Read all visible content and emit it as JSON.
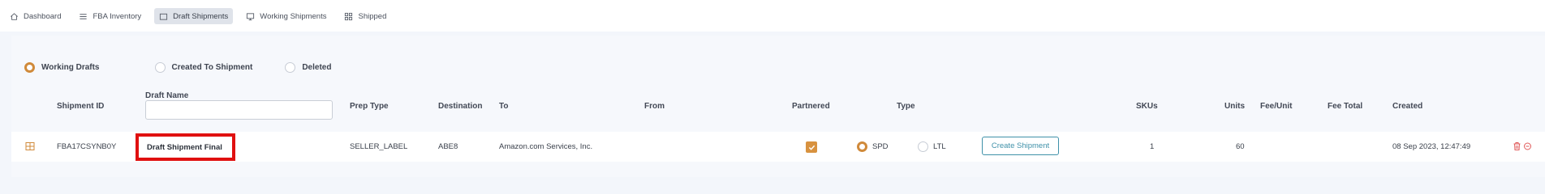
{
  "nav": {
    "items": [
      {
        "label": "Dashboard",
        "icon": "home-icon"
      },
      {
        "label": "FBA Inventory",
        "icon": "list-icon"
      },
      {
        "label": "Draft Shipments",
        "icon": "folder-icon",
        "active": true
      },
      {
        "label": "Working Shipments",
        "icon": "monitor-icon"
      },
      {
        "label": "Shipped",
        "icon": "grid-icon"
      }
    ]
  },
  "filters": {
    "working_drafts": "Working Drafts",
    "created_to_shipment": "Created To Shipment",
    "deleted": "Deleted",
    "selected": "Working Drafts"
  },
  "table": {
    "headers": {
      "shipment_id": "Shipment ID",
      "draft_name": "Draft Name",
      "prep_type": "Prep Type",
      "destination": "Destination",
      "to": "To",
      "from": "From",
      "partnered": "Partnered",
      "type": "Type",
      "skus": "SKUs",
      "units": "Units",
      "fee_unit": "Fee/Unit",
      "fee_total": "Fee Total",
      "created": "Created"
    },
    "draft_name_filter_value": "",
    "rows": [
      {
        "shipment_id": "FBA17CSYNB0Y",
        "draft_name": "Draft Shipment Final",
        "prep_type": "SELLER_LABEL",
        "destination": "ABE8",
        "to": "Amazon.com Services, Inc.",
        "from": "",
        "partnered": true,
        "type_spd": "SPD",
        "type_ltl": "LTL",
        "type_selected": "SPD",
        "create_button": "Create Shipment",
        "skus": "1",
        "units": "60",
        "fee_unit": "",
        "fee_total": "",
        "created": "08 Sep 2023, 12:47:49"
      }
    ]
  },
  "colors": {
    "accent": "#d08a3a",
    "highlight_border": "#e01010",
    "button_teal": "#3f91a9",
    "delete_red": "#e05a5a"
  }
}
